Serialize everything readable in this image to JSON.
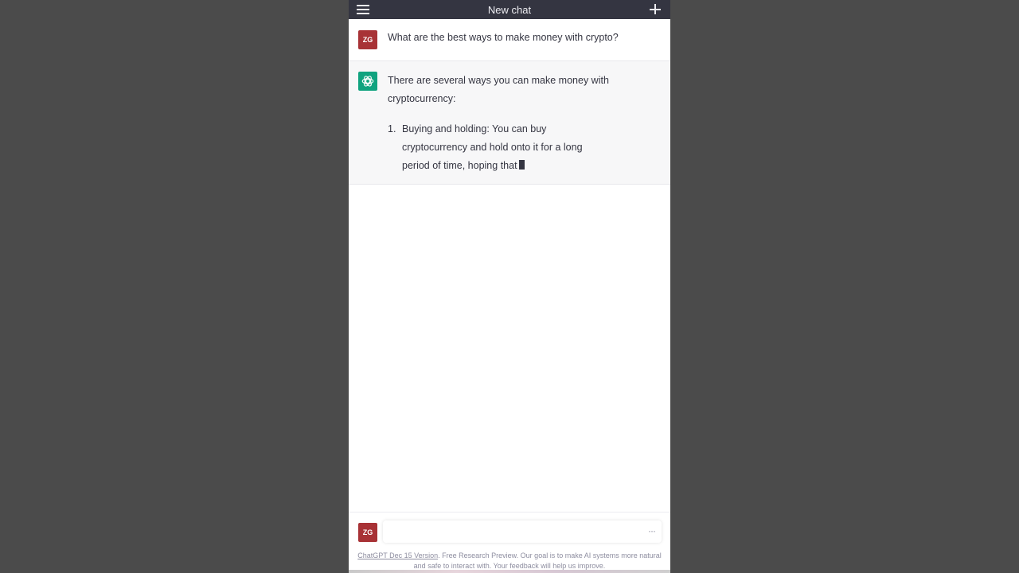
{
  "header": {
    "title": "New chat",
    "menu_icon": "hamburger-icon",
    "new_icon": "plus-icon"
  },
  "conversation": {
    "user": {
      "avatar_initials": "ZG",
      "text": "What are the best ways to make money with crypto?"
    },
    "assistant": {
      "avatar_icon": "openai-logo-icon",
      "intro": "There are several ways you can make money with cryptocurrency:",
      "list": [
        {
          "number": "1.",
          "text": "Buying and holding: You can buy cryptocurrency and hold onto it for a long period of time, hoping that"
        }
      ]
    }
  },
  "composer": {
    "avatar_initials": "ZG",
    "placeholder": "",
    "more_icon": "ellipsis-icon"
  },
  "footer": {
    "link": "ChatGPT Dec 15 Version",
    "text": ". Free Research Preview. Our goal is to make AI systems more natural and safe to interact with. Your feedback will help us improve."
  },
  "colors": {
    "header_bg": "#343541",
    "user_avatar": "#a83236",
    "assistant_avatar": "#10a37f",
    "assistant_bg": "#f7f7f8"
  }
}
